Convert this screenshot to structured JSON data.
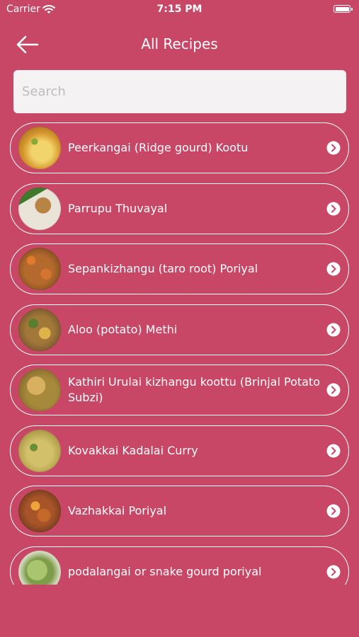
{
  "status_bar": {
    "carrier": "Carrier",
    "time": "7:15 PM"
  },
  "nav": {
    "title": "All Recipes",
    "back_icon": "arrow-left-icon"
  },
  "search": {
    "placeholder": "Search",
    "value": ""
  },
  "recipes": [
    {
      "name": "Peerkangai (Ridge gourd) Kootu"
    },
    {
      "name": "Parrupu Thuvayal"
    },
    {
      "name": "Sepankizhangu (taro root) Poriyal"
    },
    {
      "name": "Aloo (potato) Methi"
    },
    {
      "name": "Kathiri Urulai kizhangu koottu (Brinjal Potato Subzi)"
    },
    {
      "name": "Kovakkai Kadalai Curry"
    },
    {
      "name": "Vazhakkai Poriyal"
    },
    {
      "name": "podalangai or snake gourd poriyal"
    }
  ],
  "colors": {
    "background": "#c94766",
    "search_bg": "#f4f2f3",
    "foreground": "#ffffff"
  }
}
